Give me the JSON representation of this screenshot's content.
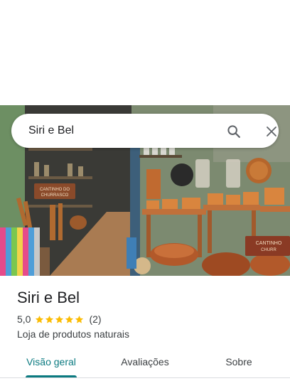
{
  "search": {
    "query": "Siri e Bel",
    "search_icon": "search-icon",
    "close_icon": "close-icon"
  },
  "hero": {
    "sign_left": "CANTINHO DO CHURRASCO",
    "sign_right": "CANTINHO CHURR"
  },
  "place": {
    "name": "Siri e Bel",
    "rating": "5,0",
    "stars": 5,
    "review_count": "(2)",
    "category": "Loja de produtos naturais"
  },
  "tabs": [
    {
      "label": "Visão geral",
      "active": true
    },
    {
      "label": "Avaliações",
      "active": false
    },
    {
      "label": "Sobre",
      "active": false
    }
  ],
  "colors": {
    "accent": "#0b7a80",
    "star": "#fbbc04",
    "text_primary": "#202124",
    "text_secondary": "#3c4043"
  }
}
